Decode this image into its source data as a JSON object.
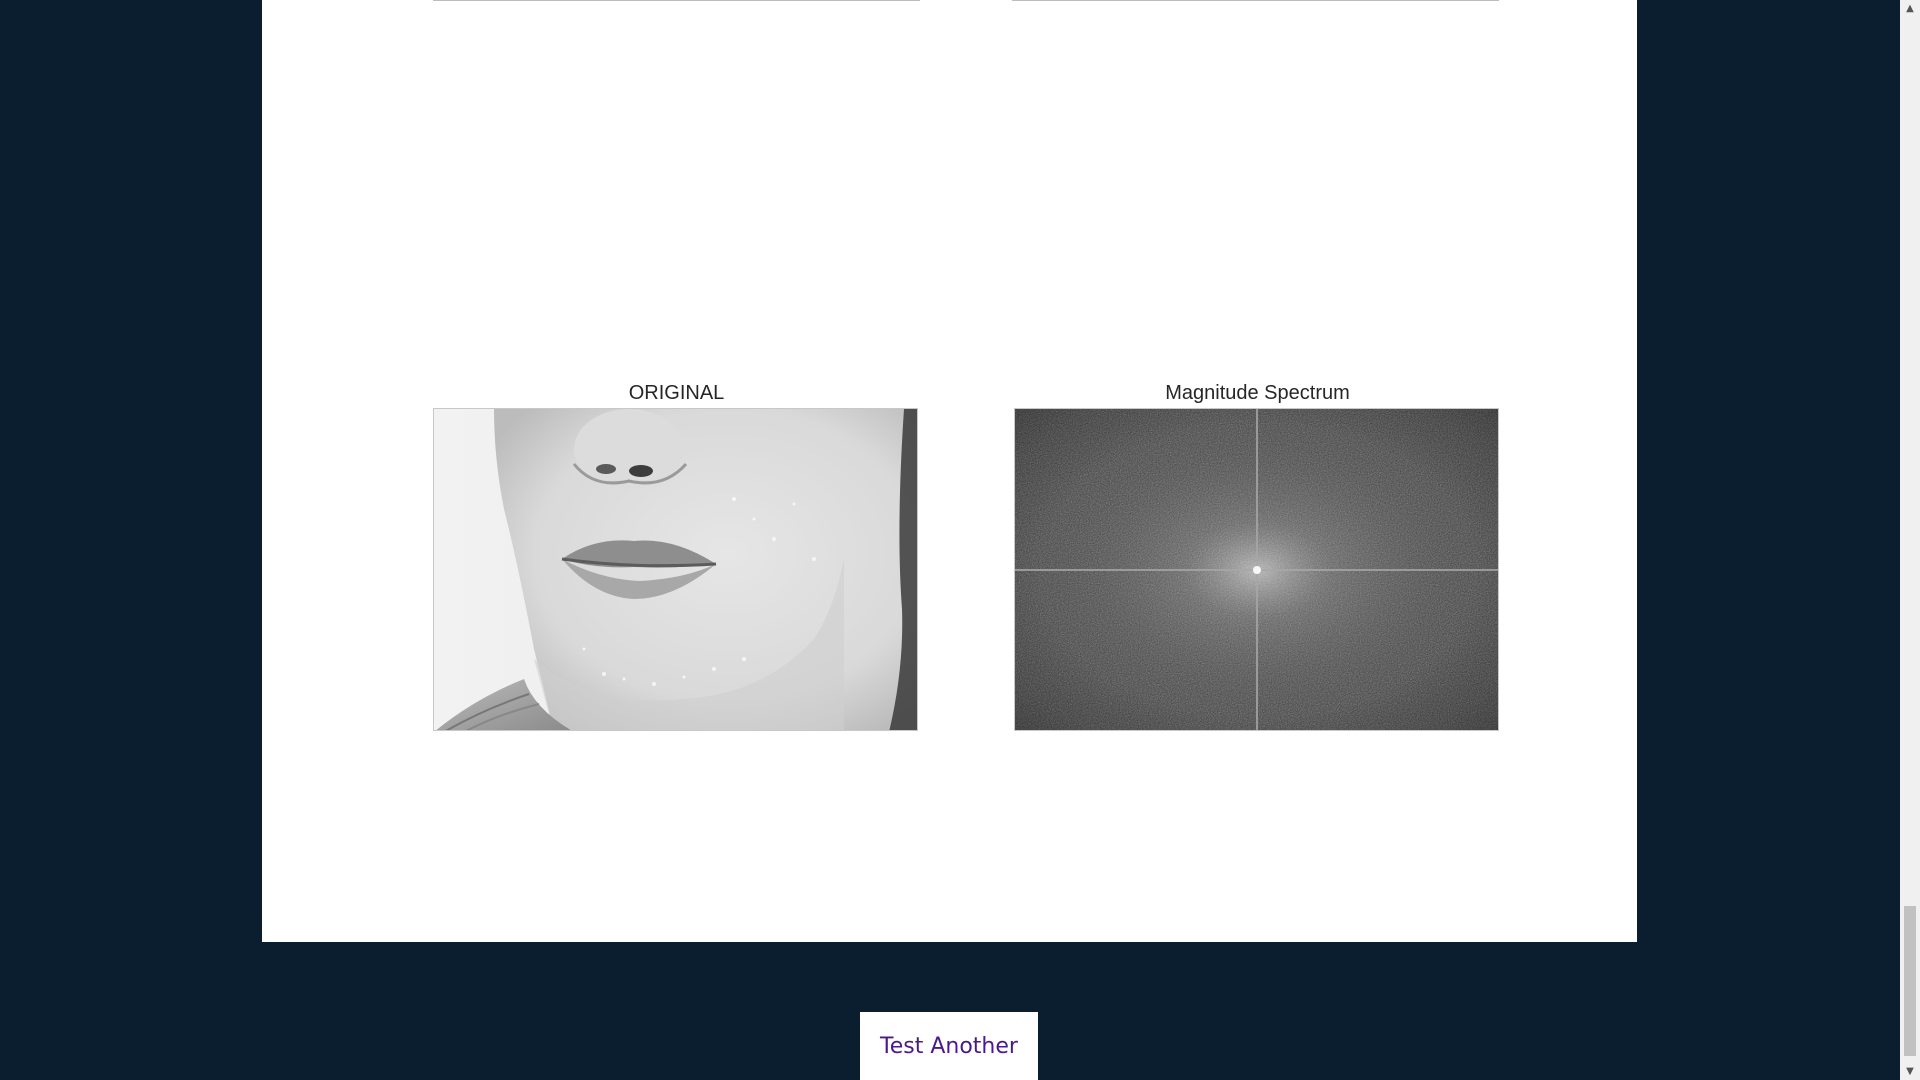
{
  "figures": {
    "original": {
      "title": "ORIGINAL",
      "image_desc_icon": "face-photo"
    },
    "spectrum": {
      "title": "Magnitude Spectrum",
      "image_desc_icon": "fft-spectrum"
    }
  },
  "actions": {
    "test_another_label": "Test Another"
  },
  "colors": {
    "page_background": "#0b1e30",
    "panel_background": "#ffffff",
    "button_text": "#4b1a8a"
  },
  "scrollbar": {
    "up_icon": "chevron-up-icon",
    "down_icon": "chevron-down-icon"
  }
}
